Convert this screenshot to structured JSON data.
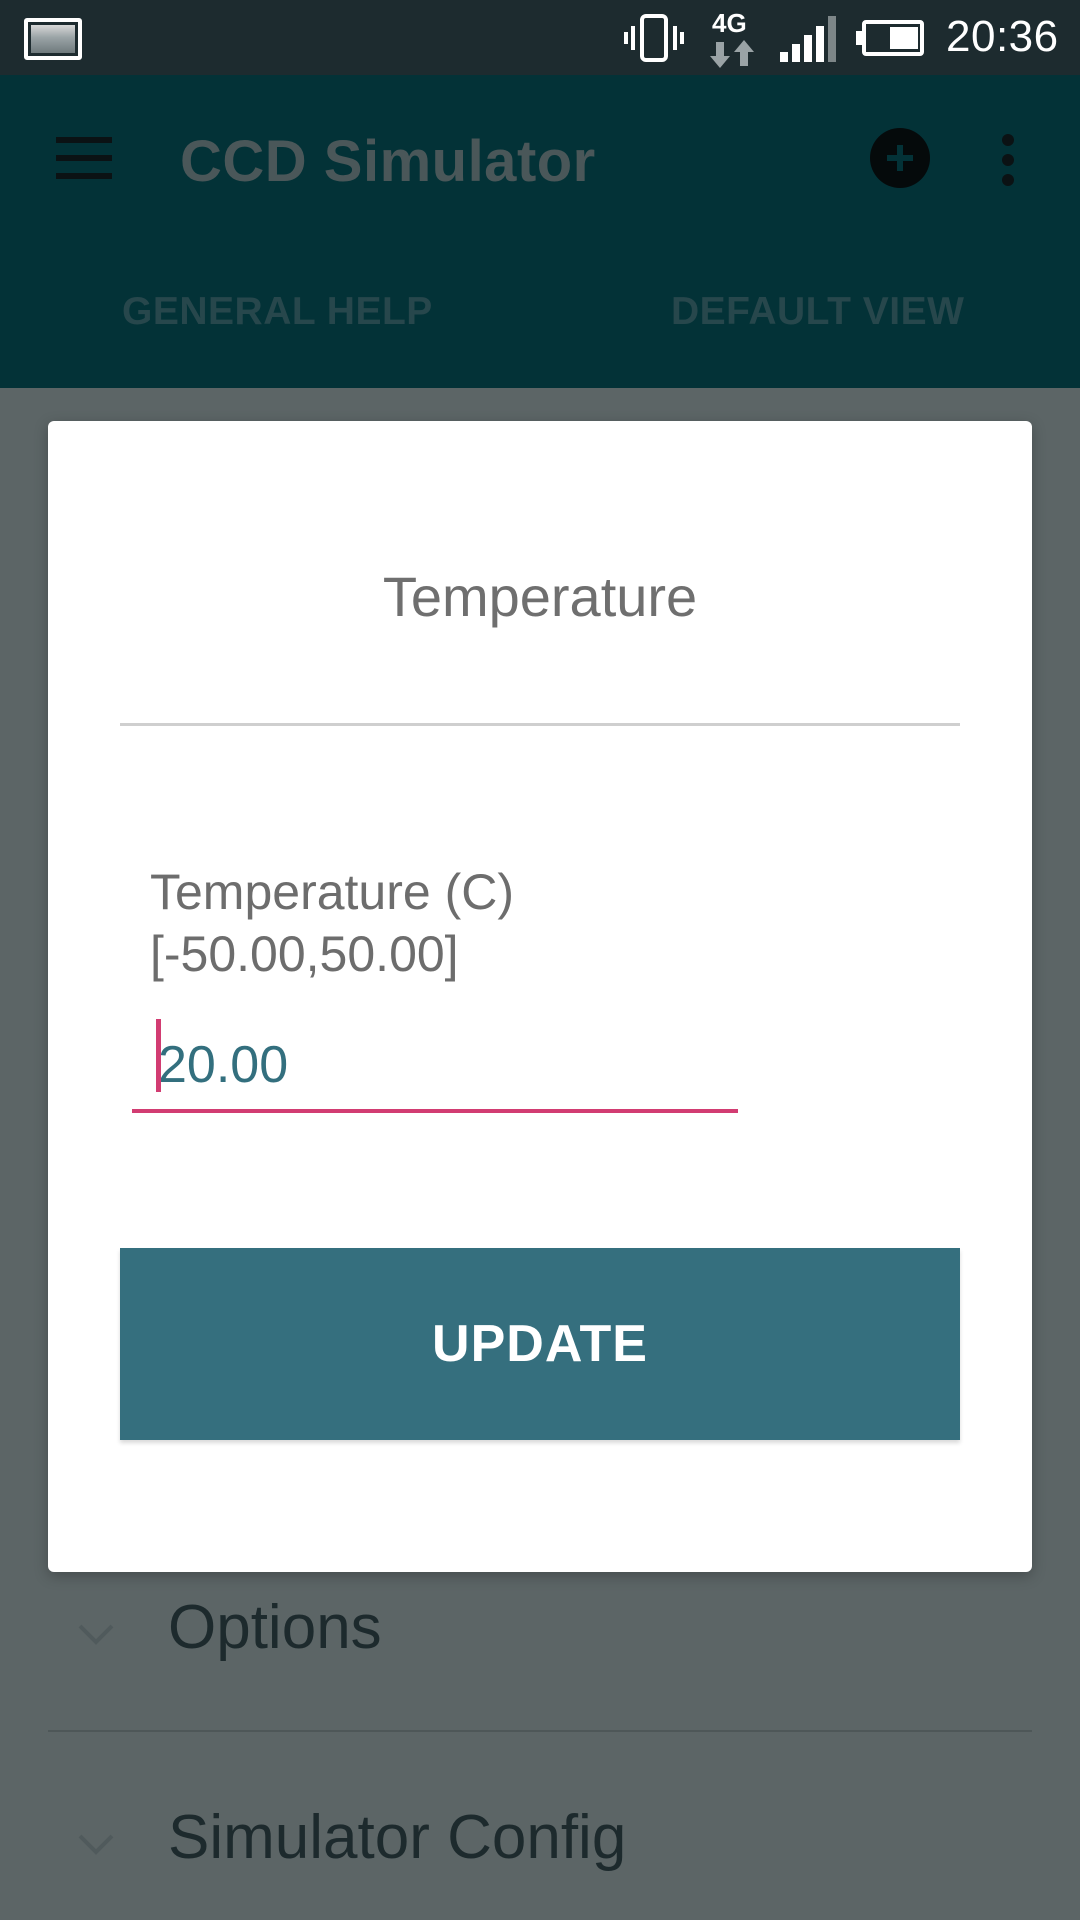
{
  "status_bar": {
    "time": "20:36",
    "network_label": "4G",
    "icons": [
      "notification-image-icon",
      "vibrate-icon",
      "4g-data-icon",
      "signal-icon",
      "battery-icon"
    ]
  },
  "app_bar": {
    "title": "CCD Simulator",
    "tabs": [
      {
        "label": "GENERAL HELP"
      },
      {
        "label": "DEFAULT VIEW"
      }
    ],
    "icons": [
      "menu-icon",
      "add-icon",
      "overflow-icon"
    ]
  },
  "background_list": {
    "items": [
      {
        "label": "Options"
      },
      {
        "label": "Simulator Config"
      }
    ]
  },
  "dialog": {
    "title": "Temperature",
    "field_label_line1": "Temperature (C)",
    "field_label_line2": "[-50.00,50.00]",
    "field_value": "20.00",
    "button_label": "UPDATE"
  },
  "colors": {
    "app_bar": "#033237",
    "status_bar": "#1d2b2f",
    "button": "#356f7e",
    "accent": "#d23c72",
    "scrim_background": "#5c6566"
  }
}
